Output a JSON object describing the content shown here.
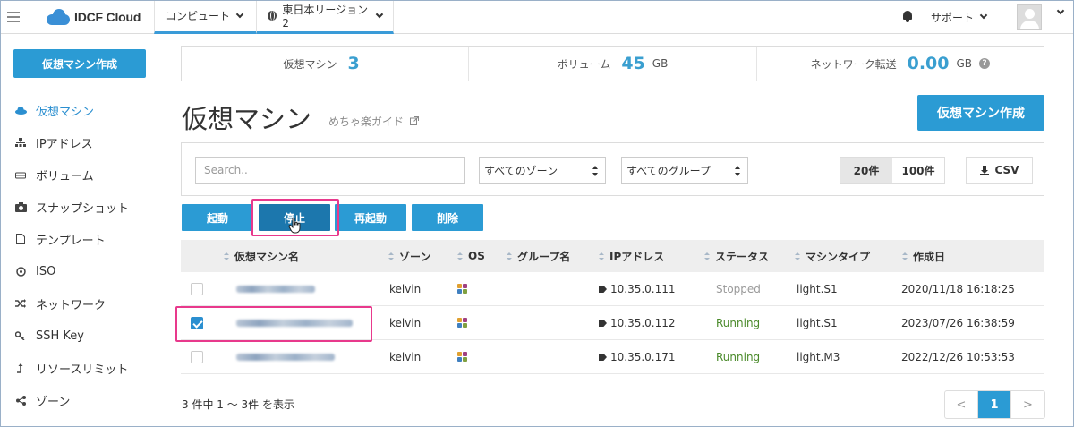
{
  "topbar": {
    "brand": "IDCF Cloud",
    "nav": [
      {
        "label": "コンピュート"
      },
      {
        "label": "東日本リージョン2"
      }
    ],
    "support_label": "サポート"
  },
  "sidebar": {
    "create_button": "仮想マシン作成",
    "items": [
      {
        "label": "仮想マシン",
        "icon": "cloud-icon"
      },
      {
        "label": "IPアドレス",
        "icon": "sitemap-icon"
      },
      {
        "label": "ボリューム",
        "icon": "hdd-icon"
      },
      {
        "label": "スナップショット",
        "icon": "camera-icon"
      },
      {
        "label": "テンプレート",
        "icon": "file-icon"
      },
      {
        "label": "ISO",
        "icon": "disc-icon"
      },
      {
        "label": "ネットワーク",
        "icon": "shuffle-icon"
      },
      {
        "label": "SSH Key",
        "icon": "key-icon"
      },
      {
        "label": "リソースリミット",
        "icon": "level-up-icon"
      },
      {
        "label": "ゾーン",
        "icon": "share-icon"
      }
    ]
  },
  "summary": {
    "vm_label": "仮想マシン",
    "vm_count": "3",
    "volume_label": "ボリューム",
    "volume_value": "45",
    "volume_unit": "GB",
    "transfer_label": "ネットワーク転送",
    "transfer_value": "0.00",
    "transfer_unit": "GB"
  },
  "page": {
    "title": "仮想マシン",
    "guide_link": "めちゃ楽ガイド",
    "create_button": "仮想マシン作成"
  },
  "filter": {
    "search_placeholder": "Search..",
    "zone_select": "すべてのゾーン",
    "group_select": "すべてのグループ",
    "page_size_options": [
      "20件",
      "100件"
    ],
    "page_size_selected": "20件",
    "csv_label": "CSV"
  },
  "actions": {
    "start": "起動",
    "stop": "停止",
    "restart": "再起動",
    "delete": "削除"
  },
  "table": {
    "columns": [
      "仮想マシン名",
      "ゾーン",
      "OS",
      "グループ名",
      "IPアドレス",
      "ステータス",
      "マシンタイプ",
      "作成日"
    ],
    "rows": [
      {
        "checked": false,
        "zone": "kelvin",
        "group": "",
        "ip": "10.35.0.111",
        "status": "Stopped",
        "type": "light.S1",
        "created": "2020/11/18 16:18:25"
      },
      {
        "checked": true,
        "zone": "kelvin",
        "group": "",
        "ip": "10.35.0.112",
        "status": "Running",
        "type": "light.S1",
        "created": "2023/07/26 16:38:59"
      },
      {
        "checked": false,
        "zone": "kelvin",
        "group": "",
        "ip": "10.35.0.171",
        "status": "Running",
        "type": "light.M3",
        "created": "2022/12/26 10:53:53"
      }
    ]
  },
  "footer": {
    "count_text": "3 件中 1 〜 3件 を表示",
    "prev": "<",
    "current_page": "1",
    "next": ">"
  },
  "colors": {
    "accent": "#2b9bd4",
    "highlight": "#e8398c",
    "running": "#4a8a2a",
    "stopped": "#999999"
  }
}
